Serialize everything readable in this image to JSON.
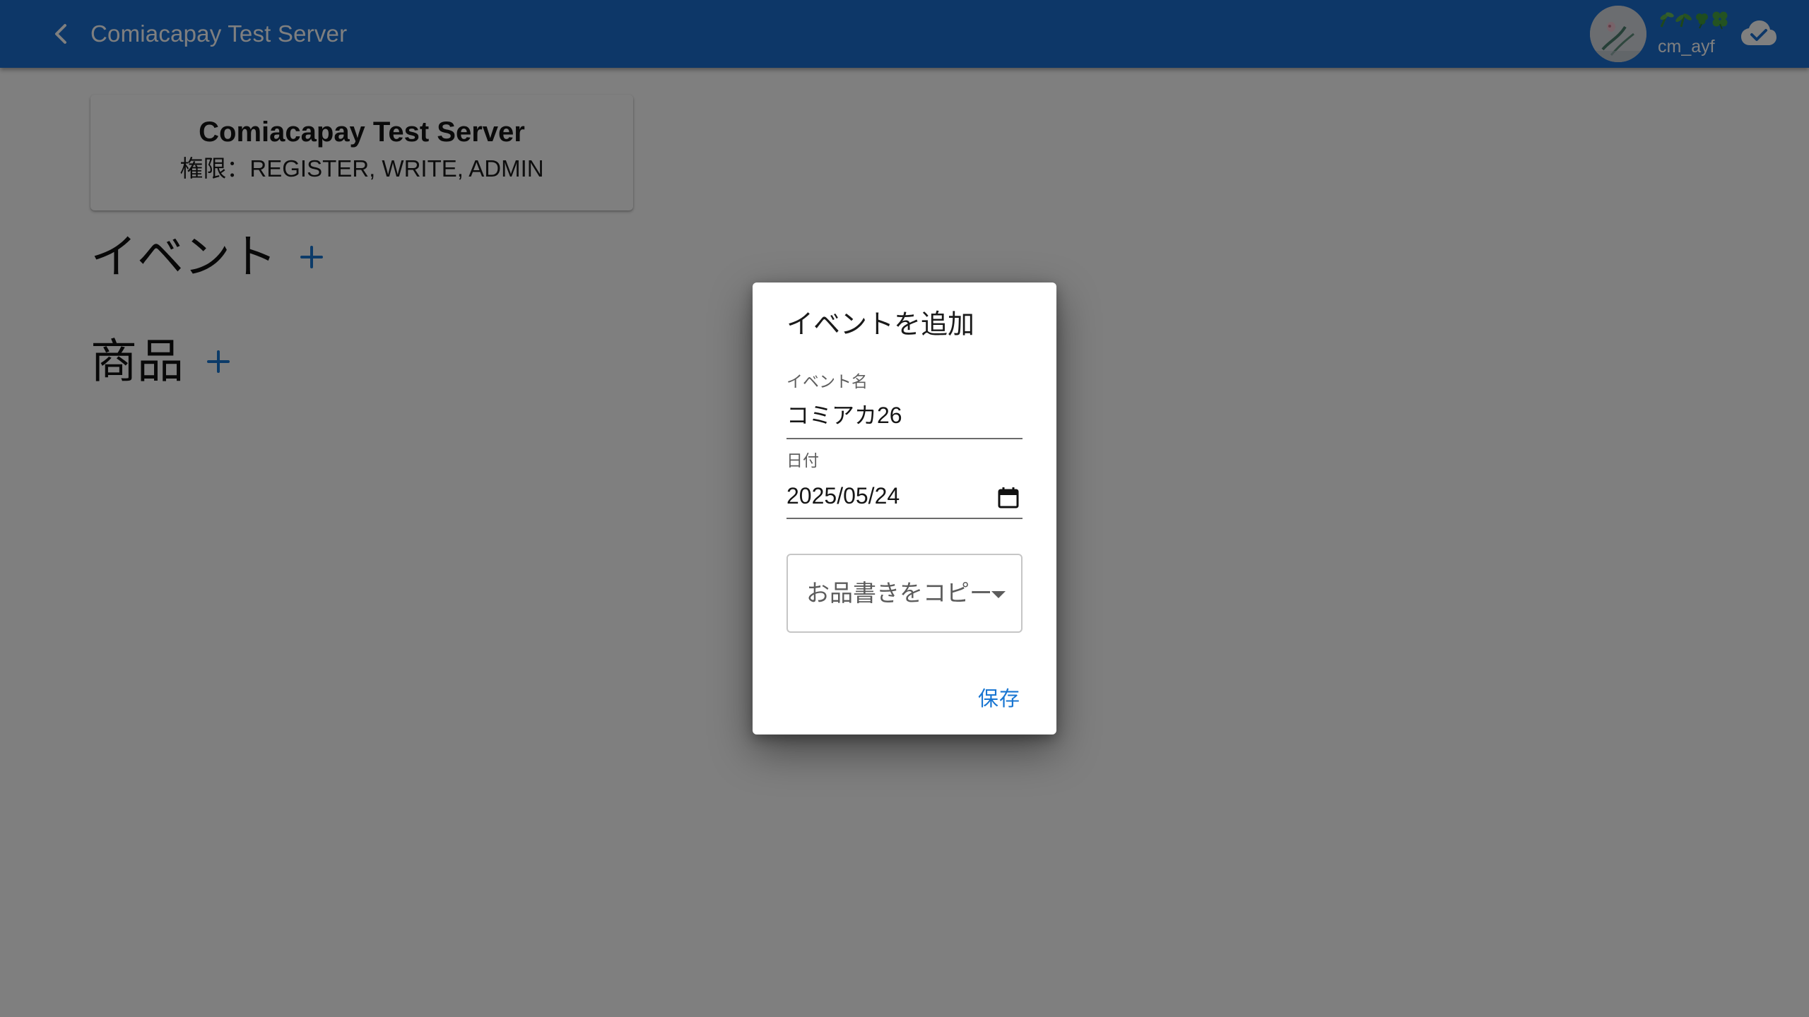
{
  "app_bar": {
    "title": "Comiacapay Test Server",
    "user_emoji": "🌱🌿☘️🍀",
    "user_name": "cm_ayf",
    "back_icon": "chevron-left-icon",
    "sync_icon": "cloud-done-icon"
  },
  "server_card": {
    "name": "Comiacapay Test Server",
    "permissions": "権限：REGISTER, WRITE, ADMIN"
  },
  "sections": {
    "events": {
      "title": "イベント",
      "add_icon": "plus-icon"
    },
    "products": {
      "title": "商品",
      "add_icon": "plus-icon"
    }
  },
  "dialog": {
    "title": "イベントを追加",
    "event_name": {
      "label": "イベント名",
      "value": "コミアカ26"
    },
    "date": {
      "label": "日付",
      "value": "2025/05/24"
    },
    "copy_menu": {
      "placeholder": "お品書きをコピー"
    },
    "save_label": "保存"
  },
  "colors": {
    "app_bar": "#1a6fd1",
    "accent": "#1976d2",
    "scrim": "rgba(0,0,0,0.5)"
  }
}
